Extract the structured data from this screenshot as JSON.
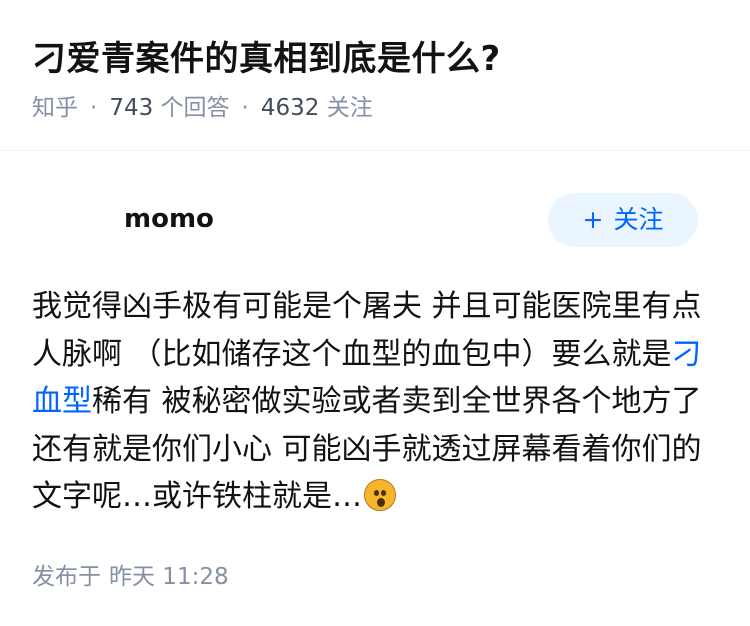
{
  "question": {
    "title": "刁爱青案件的真相到底是什么?",
    "source": "知乎",
    "answers_count": "743",
    "answers_label": "个回答",
    "followers_count": "4632",
    "followers_label": "关注"
  },
  "answer": {
    "author": "momo",
    "follow_button": "关注",
    "content_before_link": "我觉得凶手极有可能是个屠夫 并且可能医院里有点人脉啊 （比如储存这个血型的血包中）要么就是",
    "content_link": "刁血型",
    "content_after_link": "稀有 被秘密做实验或者卖到全世界各个地方了 还有就是你们小心 可能凶手就透过屏幕看着你们的文字呢…或许铁柱就是…",
    "emoji_name": "hushed-face-emoji",
    "published_label": "发布于",
    "published_time": "昨天 11:28"
  },
  "colors": {
    "accent": "#0066ff",
    "muted": "#8590a6",
    "follow_bg": "#ebf5ff"
  }
}
